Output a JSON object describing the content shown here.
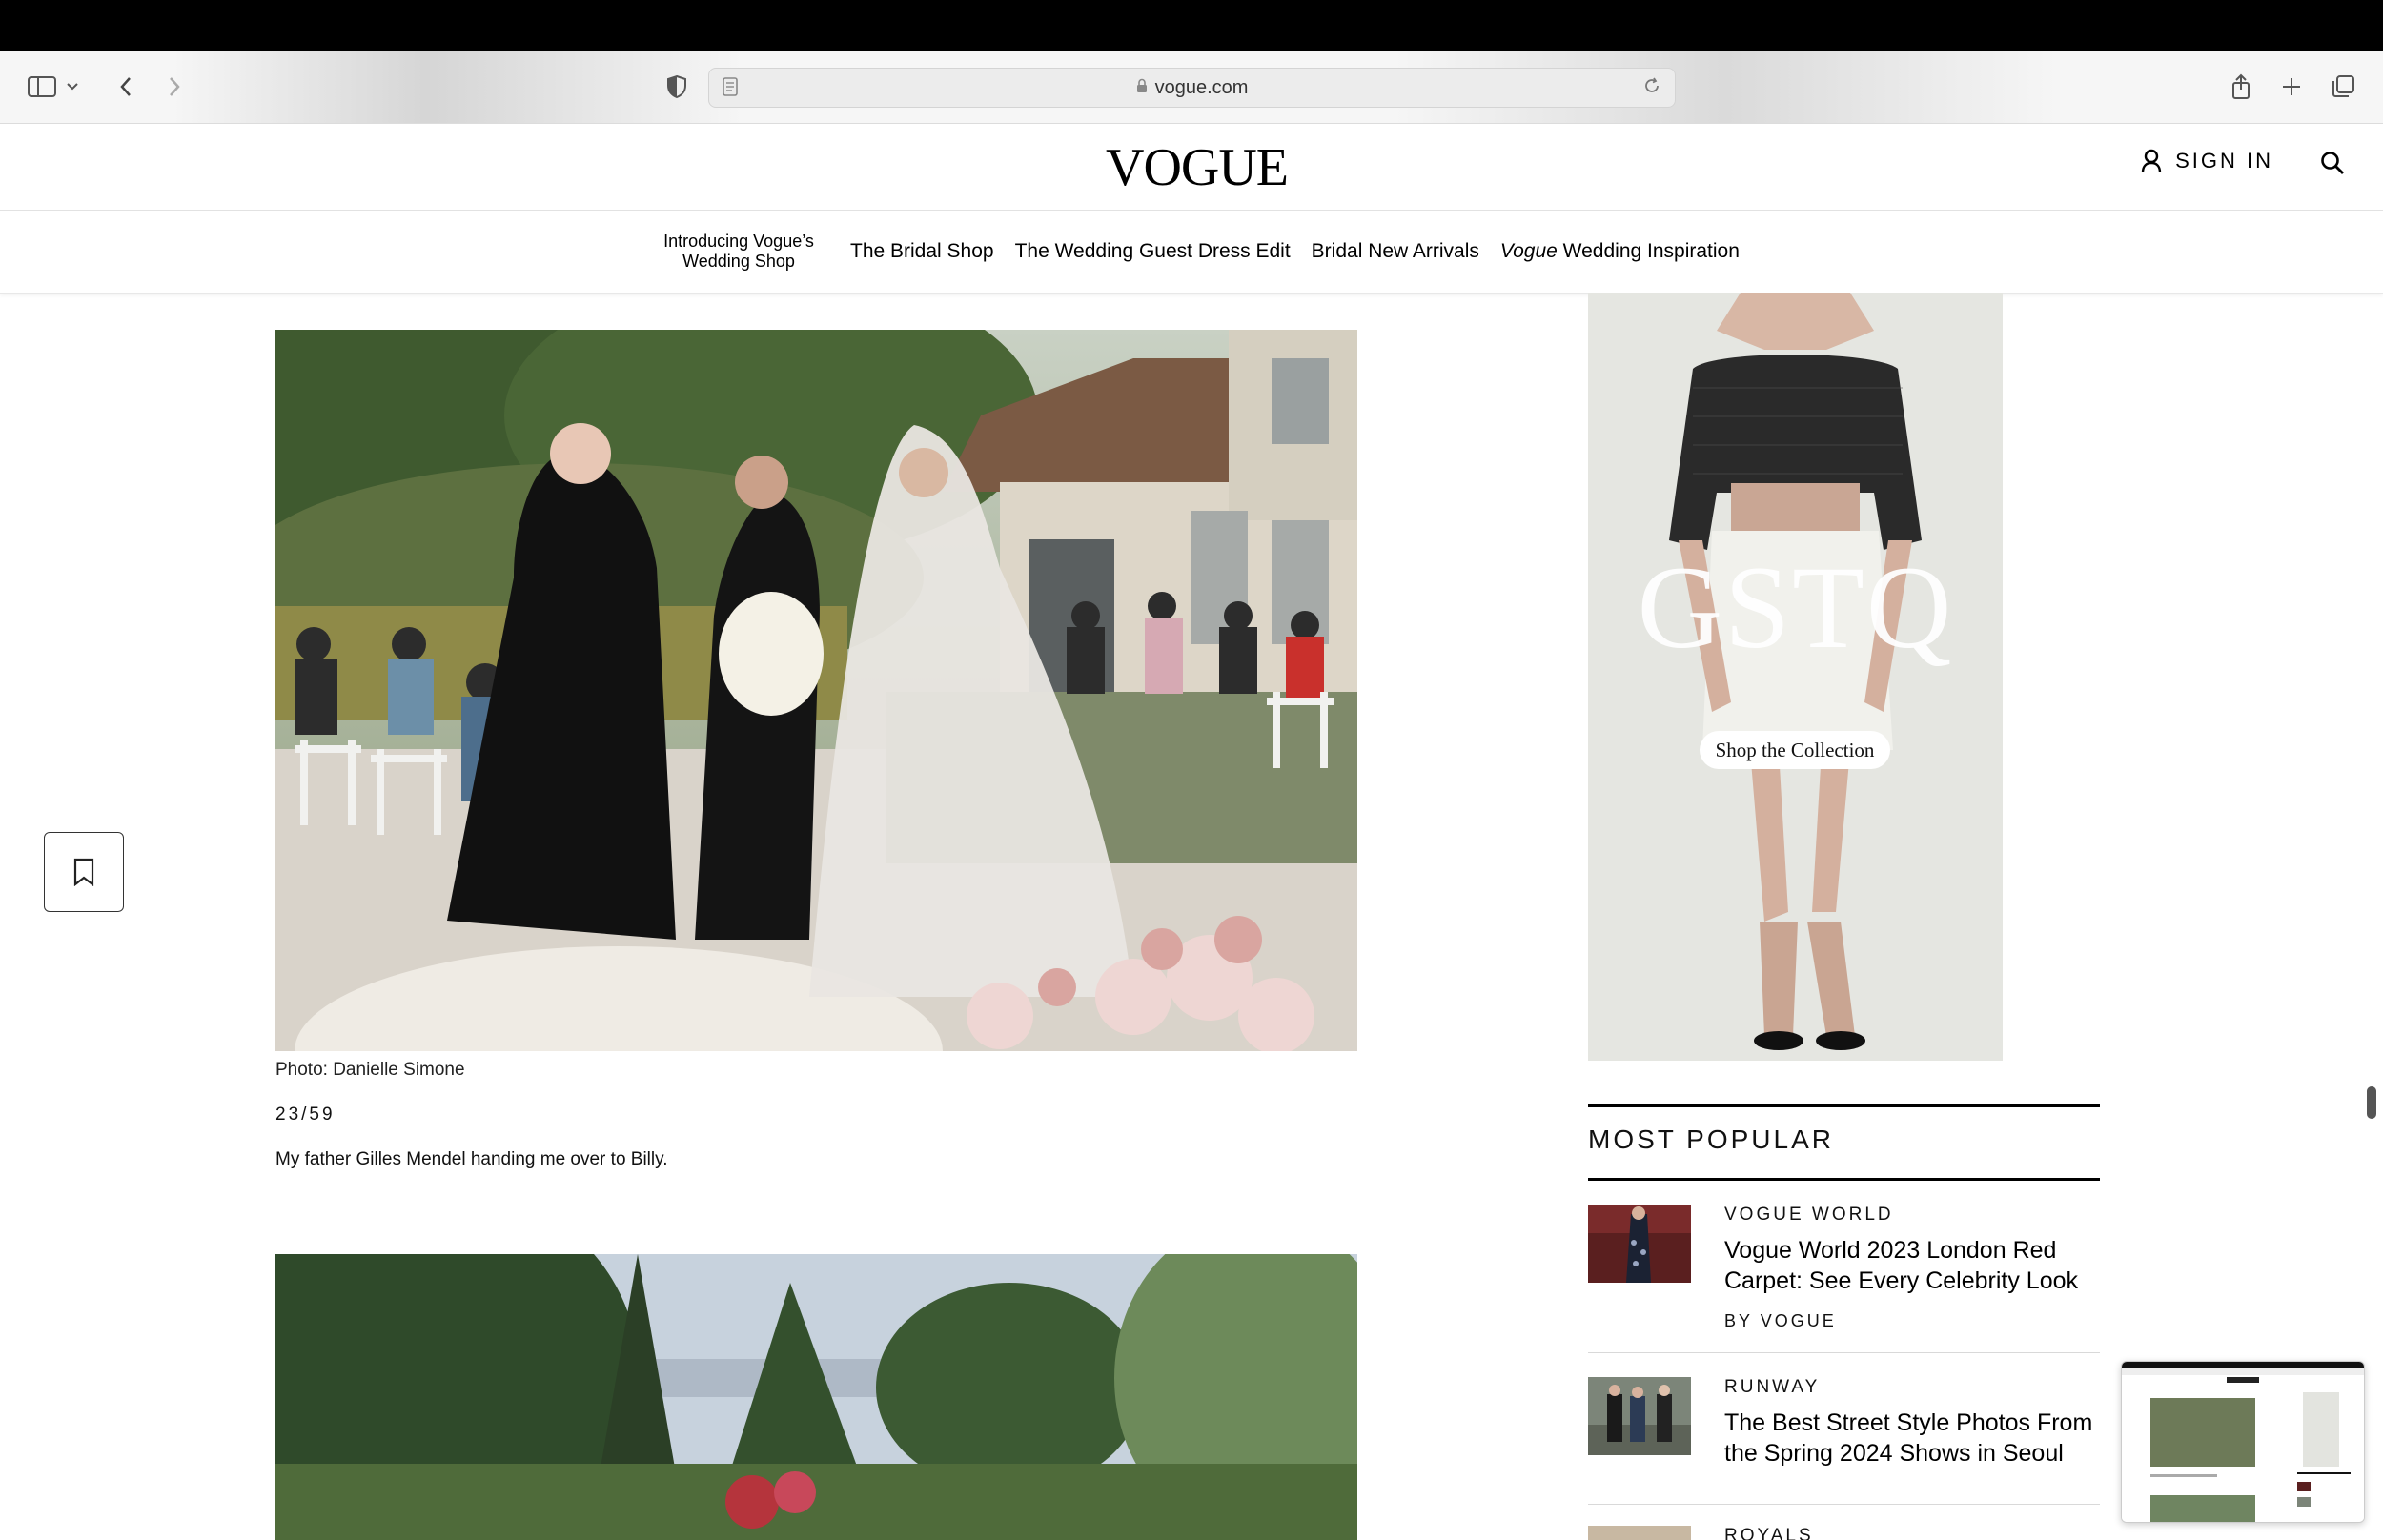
{
  "browser": {
    "url": "vogue.com"
  },
  "site": {
    "logo": "VOGUE",
    "sign_in": "SIGN IN"
  },
  "nav": {
    "items": [
      {
        "label_line1": "Introducing Vogue’s",
        "label_line2": "Wedding Shop"
      },
      {
        "label": "The Bridal Shop"
      },
      {
        "label": "The Wedding Guest Dress Edit"
      },
      {
        "label": "Bridal New Arrivals"
      },
      {
        "label_italic": "Vogue",
        "label_rest": " Wedding Inspiration"
      }
    ]
  },
  "article": {
    "photo_credit": "Photo: Danielle Simone",
    "counter": "23/59",
    "description": "My father Gilles Mendel handing me over to Billy."
  },
  "ad": {
    "brand": "GSTQ",
    "cta": "Shop the Collection"
  },
  "most_popular": {
    "title": "MOST POPULAR",
    "stories": [
      {
        "kicker": "VOGUE WORLD",
        "headline": "Vogue World 2023 London Red Carpet: See Every Celebrity Look",
        "byline": "BY VOGUE"
      },
      {
        "kicker": "RUNWAY",
        "headline": "The Best Street Style Photos From the Spring 2024 Shows in Seoul"
      },
      {
        "kicker": "ROYALS"
      }
    ]
  }
}
